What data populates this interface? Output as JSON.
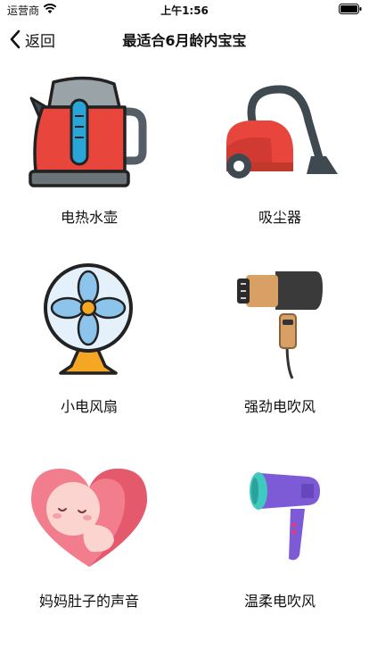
{
  "status_bar": {
    "carrier": "运营商",
    "time": "上午1:56"
  },
  "nav": {
    "back_label": "返回",
    "title": "最适合6月龄内宝宝"
  },
  "items": [
    {
      "label": "电热水壶",
      "icon": "electric-kettle-icon"
    },
    {
      "label": "吸尘器",
      "icon": "vacuum-cleaner-icon"
    },
    {
      "label": "小电风扇",
      "icon": "electric-fan-icon"
    },
    {
      "label": "强劲电吹风",
      "icon": "hair-dryer-icon"
    },
    {
      "label": "妈妈肚子的声音",
      "icon": "womb-baby-heart-icon"
    },
    {
      "label": "温柔电吹风",
      "icon": "gentle-hair-dryer-icon"
    }
  ]
}
